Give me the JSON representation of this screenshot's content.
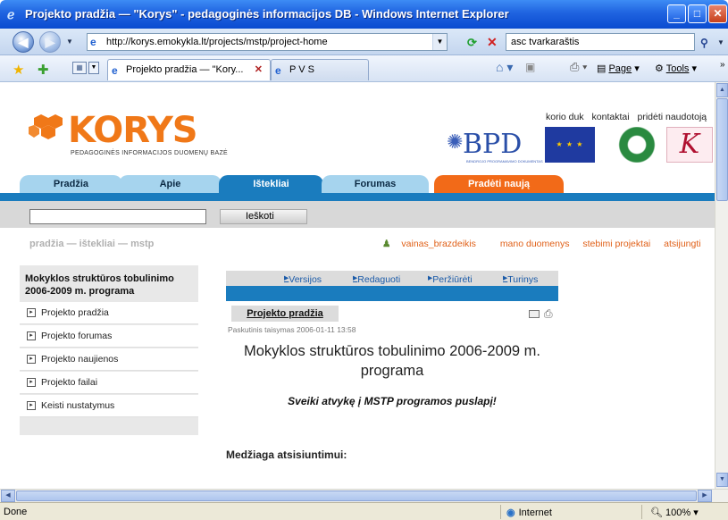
{
  "window": {
    "title": "Projekto pradžia — \"Korys\" - pedagoginės informacijos DB - Windows Internet Explorer",
    "controls": {
      "minimize": "_",
      "maximize": "□",
      "close": "✕"
    }
  },
  "address_bar": {
    "url": "http://korys.emokykla.lt/projects/mstp/project-home",
    "search_value": "asc tvarkaraštis"
  },
  "tabs": [
    {
      "label": "Projekto pradžia — \"Kory...",
      "active": true
    },
    {
      "label": "P V S",
      "active": false
    }
  ],
  "command_bar": {
    "page": "Page",
    "tools": "Tools"
  },
  "site": {
    "logo_text": "KORYS",
    "logo_subtitle": "PEDAGOGINĖS INFORMACIJOS DUOMENŲ BAZĖ",
    "top_links": [
      "korio duk",
      "kontaktai",
      "pridėti naudotoją"
    ],
    "partner_logo_text": "BPD",
    "partner_logo_small": "BENDROJO PROGRAMAVIMO DOKUMENTAS",
    "fourth_logo": "K"
  },
  "nav": {
    "tabs": [
      "Pradžia",
      "Apie",
      "Ištekliai",
      "Forumas",
      "Pradėti naują"
    ],
    "active": "Ištekliai"
  },
  "site_search": {
    "value": "",
    "button": "Ieškoti"
  },
  "breadcrumb": "pradžia — ištekliai — mstp",
  "user_links": [
    "vainas_brazdeikis",
    "mano duomenys",
    "stebimi projektai",
    "atsijungti"
  ],
  "sidebar": {
    "heading": "Mokyklos struktūros tobulinimo 2006-2009 m. programa",
    "items": [
      {
        "label": "Projekto pradžia"
      },
      {
        "label": "Projekto forumas"
      },
      {
        "label": "Projekto naujienos"
      },
      {
        "label": "Projekto failai"
      },
      {
        "label": "Keisti nustatymus"
      }
    ]
  },
  "subtabs": [
    "Versijos",
    "Redaguoti",
    "Peržiūrėti",
    "Turinys"
  ],
  "page_tab": "Projekto pradžia",
  "last_modified": "Paskutinis taisymas 2006-01-11 13:58",
  "main_title": "Mokyklos struktūros tobulinimo 2006-2009 m. programa",
  "welcome": "Sveiki atvykę į MSTP programos puslapį!",
  "downloads_heading": "Medžiaga atsisiuntimui:",
  "status": {
    "left": "Done",
    "zone": "Internet",
    "zoom": "100%"
  },
  "colors": {
    "accent_blue": "#1a7cbe",
    "tab_light": "#a6d4ee",
    "new_tab_orange": "#f26a18",
    "logo_orange": "#f07818",
    "link_orange": "#e06018"
  }
}
